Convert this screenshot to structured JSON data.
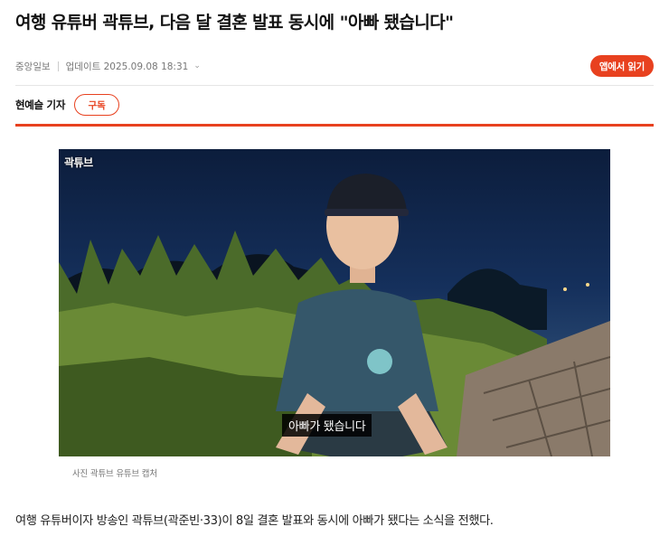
{
  "article": {
    "headline": "여행 유튜버 곽튜브, 다음 달 결혼 발표 동시에 \"아빠 됐습니다\"",
    "source": "중앙일보",
    "updated": "업데이트 2025.09.08 18:31",
    "app_button": "앱에서 읽기",
    "reporter": "현예슬 기자",
    "subscribe_button": "구독",
    "accent_color": "#e8411f",
    "photo": {
      "watermark": "곽튜브",
      "subtitle": "아빠가 됐습니다",
      "caption": "사진 곽튜브 유튜브 캡처"
    },
    "body_first_line": "여행 유튜버이자 방송인 곽튜브(곽준빈·33)이 8일 결혼 발표와 동시에 아빠가 됐다는 소식을 전했다."
  }
}
